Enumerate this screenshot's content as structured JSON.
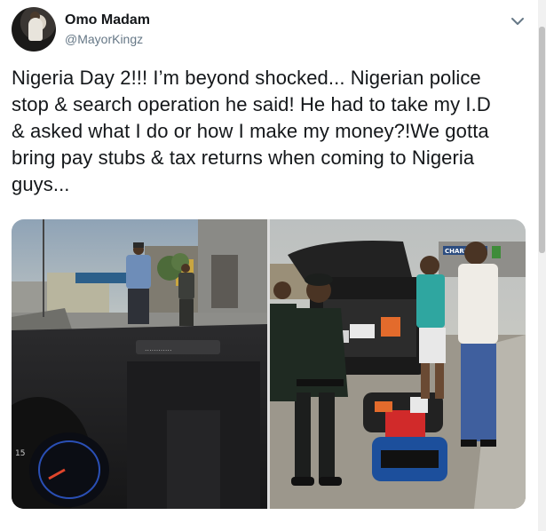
{
  "tweet": {
    "author": {
      "display_name": "Omo Madam",
      "handle": "@MayorKingz"
    },
    "menu_icon": "chevron-down-icon",
    "text_lines": [
      "Nigeria Day 2!!! I’m beyond shocked... Nigerian police",
      "stop & search operation he said! He had to take my I.D",
      "& asked what I do or how I make my money?!We gotta",
      "bring pay stubs & tax returns when coming to Nigeria",
      "guys..."
    ],
    "media": [
      {
        "name": "photo-police-stop-road"
      },
      {
        "name": "photo-car-trunk-search"
      }
    ],
    "photo_text": {
      "billboard": "CHARIM"
    }
  },
  "colors": {
    "text_primary": "#14171a",
    "text_secondary": "#657786",
    "police_uniform": "#1f2a22"
  }
}
